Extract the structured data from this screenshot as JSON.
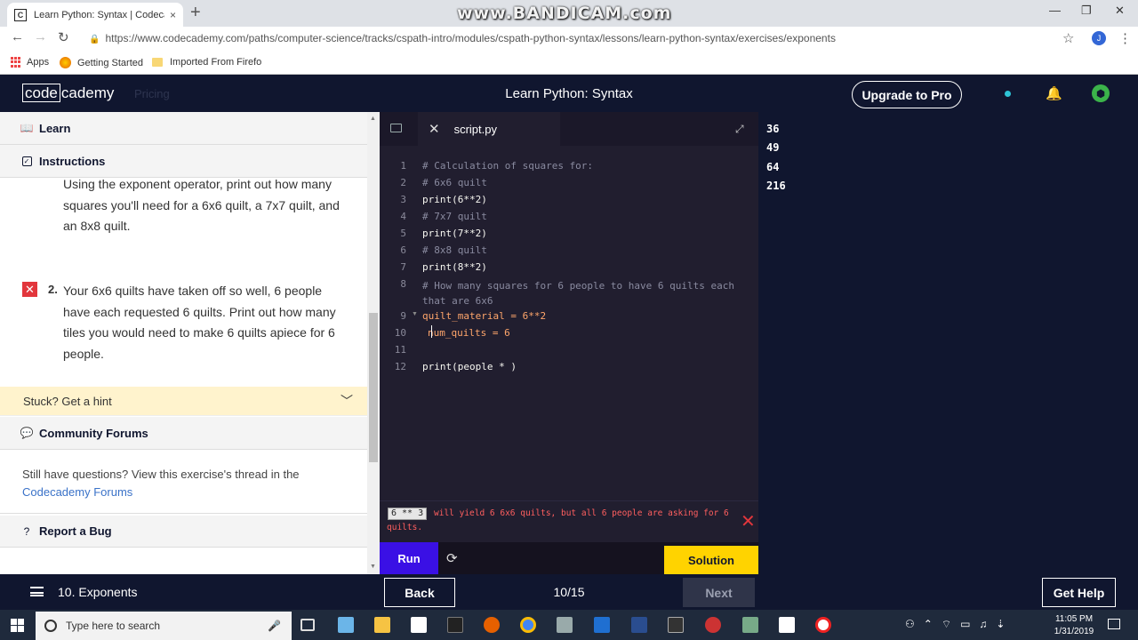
{
  "browser": {
    "tab_title": "Learn Python: Syntax | Codecade",
    "tab_close": "×",
    "new_tab": "+",
    "url": "https://www.codecademy.com/paths/computer-science/tracks/cspath-intro/modules/cspath-python-syntax/lessons/learn-python-syntax/exercises/exponents",
    "watermark": "www.BANDICAM.com",
    "account_initial": "J",
    "bookmarks": [
      "Apps",
      "Getting Started",
      "Imported From Firefo"
    ]
  },
  "header": {
    "logo_code": "code",
    "logo_rest": "cademy",
    "pricing": "Pricing",
    "course_title": "Learn Python: Syntax",
    "upgrade_label": "Upgrade to Pro"
  },
  "left_panel": {
    "learn_label": "Learn",
    "instructions_label": "Instructions",
    "task1_text": "Using the exponent operator, print out how many squares you'll need for a 6x6 quilt, a 7x7 quilt, and an 8x8 quilt.",
    "task2_number": "2.",
    "task2_text": "Your 6x6 quilts have taken off so well, 6 people have each requested 6 quilts. Print out how many tiles you would need to make 6 quilts apiece for 6 people.",
    "hint_label": "Stuck? Get a hint",
    "forums_label": "Community Forums",
    "forums_text": "Still have questions? View this exercise's thread in the",
    "forums_link": "Codecademy Forums",
    "bug_label": "Report a Bug"
  },
  "editor": {
    "filename": "script.py",
    "lines": [
      {
        "n": "1",
        "text": "# Calculation of squares for:"
      },
      {
        "n": "2",
        "text": "# 6x6 quilt"
      },
      {
        "n": "3",
        "text": "print(6**2)"
      },
      {
        "n": "4",
        "text": "# 7x7 quilt"
      },
      {
        "n": "5",
        "text": "print(7**2)"
      },
      {
        "n": "6",
        "text": "# 8x8 quilt"
      },
      {
        "n": "7",
        "text": "print(8**2)"
      },
      {
        "n": "8",
        "text": "# How many squares for 6 people to have 6 quilts each that are 6x6"
      },
      {
        "n": "9",
        "text": "quilt_material = 6**2"
      },
      {
        "n": "10",
        "text": "num_quilts = 6"
      },
      {
        "n": "11",
        "text": ""
      },
      {
        "n": "12",
        "text": "print(people * )"
      }
    ],
    "error_code": "6 ** 3",
    "error_message": "will yield 6 6x6 quilts, but all 6 people are asking for 6 quilts.",
    "run_label": "Run",
    "solution_label": "Solution"
  },
  "output": [
    "36",
    "49",
    "64",
    "216"
  ],
  "footer": {
    "lesson_label": "10. Exponents",
    "back_label": "Back",
    "progress": "10/15",
    "next_label": "Next",
    "help_label": "Get Help"
  },
  "taskbar": {
    "search_placeholder": "Type here to search",
    "time": "11:05 PM",
    "date": "1/31/2019"
  }
}
